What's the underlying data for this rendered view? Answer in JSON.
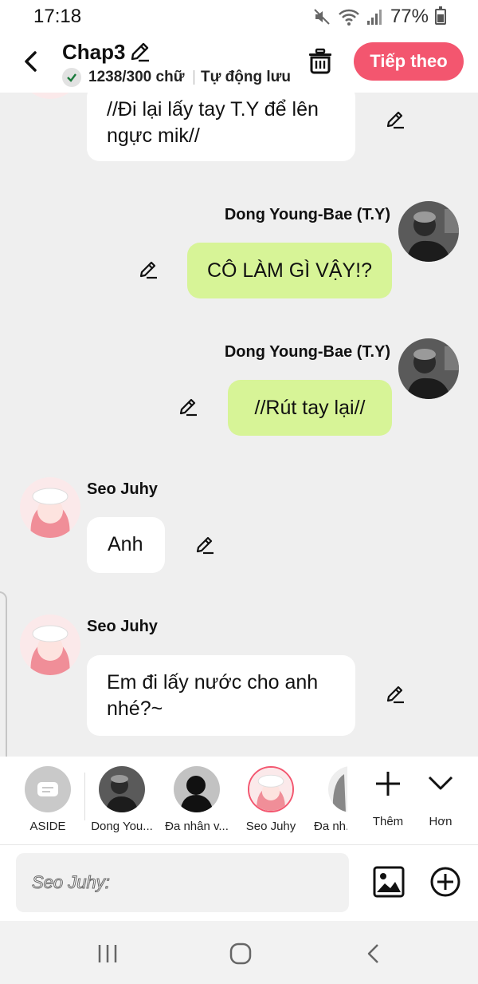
{
  "status": {
    "time": "17:18",
    "battery": "77%"
  },
  "header": {
    "title": "Chap3",
    "word_count": "1238/300 chữ",
    "autosave": "Tự động lưu",
    "next_label": "Tiếp theo",
    "accent": "#f3566f"
  },
  "messages": [
    {
      "side": "left",
      "sender": "",
      "text": "//Đi lại lấy tay T.Y để lên ngực mik//"
    },
    {
      "side": "right",
      "sender": "Dong Young-Bae (T.Y)",
      "text": "CÔ LÀM GÌ VẬY!?"
    },
    {
      "side": "right",
      "sender": "Dong Young-Bae (T.Y)",
      "text": "//Rút tay lại//"
    },
    {
      "side": "left",
      "sender": "Seo Juhy",
      "text": "Anh"
    },
    {
      "side": "left",
      "sender": "Seo Juhy",
      "text": "Em đi lấy nước cho anh nhé?~"
    }
  ],
  "characters": [
    {
      "label": "ASIDE"
    },
    {
      "label": "Dong You..."
    },
    {
      "label": "Đa nhân v..."
    },
    {
      "label": "Seo Juhy"
    },
    {
      "label": "Đa nh..."
    }
  ],
  "actions": {
    "add": "Thêm",
    "more": "Hơn"
  },
  "composer": {
    "placeholder": "Seo Juhy:"
  },
  "colors": {
    "right_bubble": "#d7f497",
    "left_bubble": "#ffffff",
    "selected_ring": "#f3566f"
  }
}
